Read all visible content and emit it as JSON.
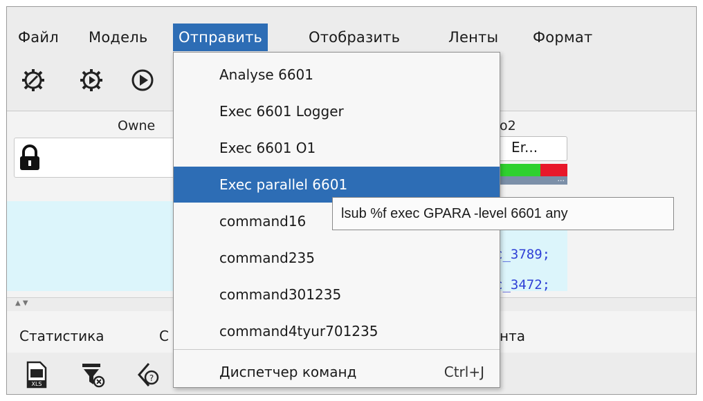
{
  "menubar": {
    "items": [
      "Файл",
      "Модель",
      "Отправить",
      "Отобразить",
      "Ленты",
      "Формат"
    ],
    "active": "Отправить"
  },
  "toolbar": {
    "icons": [
      "gear-stop-icon",
      "gear-run-icon",
      "play-circle-icon"
    ]
  },
  "table": {
    "headers": {
      "owner": "Owne",
      "right": "o2"
    },
    "cell_er": "Er...",
    "status_more": "...",
    "links": [
      "c_3789;",
      "c_3472;"
    ],
    "lock_icon": "lock-icon"
  },
  "splitter": {
    "label": "▲ ▼"
  },
  "bottom_tabs": [
    "Статистика",
    "С",
    "нта"
  ],
  "bottom_tools": {
    "icons": [
      "xls-export-icon",
      "filter-clear-icon",
      "help-tag-icon"
    ]
  },
  "dropdown": {
    "items": [
      "Analyse 6601",
      "Exec 6601 Logger",
      "Exec 6601 O1",
      "Exec parallel 6601",
      "command16",
      "command235",
      "command301235",
      "command4tyur701235"
    ],
    "selected": "Exec parallel 6601",
    "footer_item": "Диспетчер команд",
    "footer_shortcut": "Ctrl+J"
  },
  "tooltip": {
    "text": "lsub %f exec GPARA -level 6601 any"
  },
  "colors": {
    "accent": "#2d6db5",
    "link": "#2e3fd6",
    "status_green": "#2fd12f",
    "status_red": "#e8182a",
    "row_highlight": "#dcf5fb"
  }
}
